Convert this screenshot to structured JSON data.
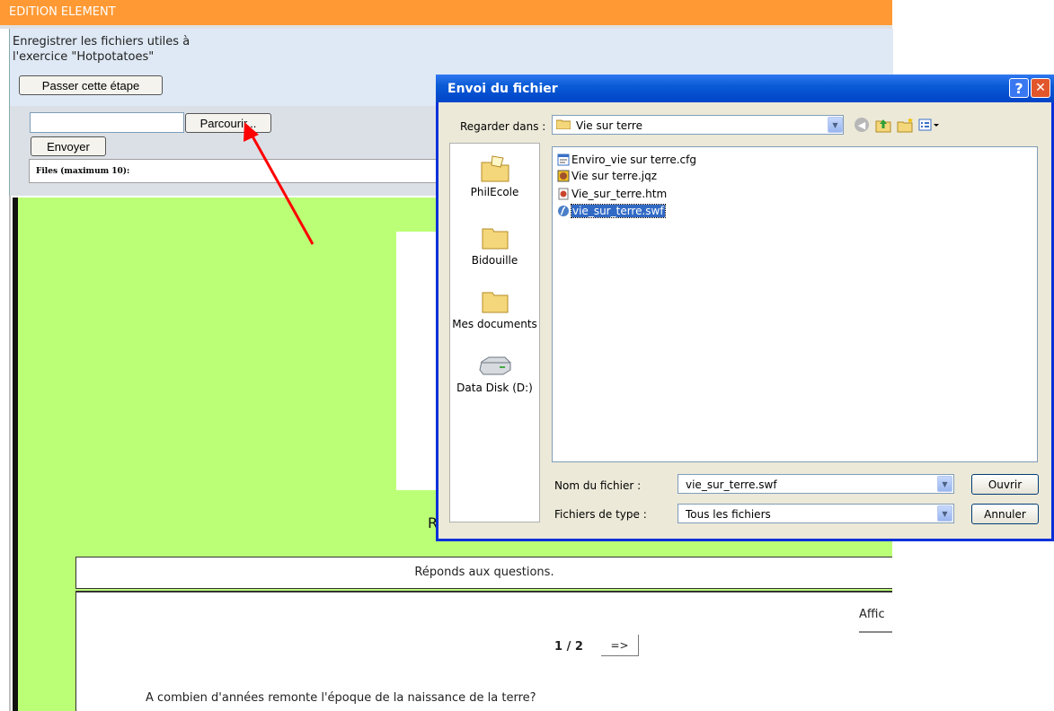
{
  "page": {
    "header_title": "EDITION ELEMENT",
    "instructions": [
      "Enregistrer les fichiers utiles à",
      "l'exercice \"Hotpotatoes\""
    ],
    "skip_button": "Passer cette étape",
    "browse_button": "Parcourir...",
    "send_button": "Envoyer",
    "files_label": "Files (maximum 10):",
    "file_input_value": ""
  },
  "exercise": {
    "partial_heading": "R",
    "instruction_bar": "Réponds aux questions.",
    "show_all_partial": "Affic",
    "page_indicator": "1 / 2",
    "next_button": "=>",
    "question": "A combien d'années remonte l'époque de la naissance de la terre?"
  },
  "dialog": {
    "title": "Envoi du fichier",
    "help_button": "?",
    "close_button": "✕",
    "look_in_label": "Regarder dans :",
    "look_in_value": "Vie sur terre",
    "places": [
      {
        "label": "PhilEcole",
        "icon": "folder-special-icon"
      },
      {
        "label": "Bidouille",
        "icon": "folder-icon"
      },
      {
        "label": "Mes documents",
        "icon": "folder-icon"
      },
      {
        "label": "Data Disk (D:)",
        "icon": "disk-drive-icon"
      }
    ],
    "files": [
      {
        "name": "Enviro_vie sur terre.cfg",
        "icon": "cfg-file-icon",
        "selected": false
      },
      {
        "name": "Vie sur terre.jqz",
        "icon": "hotpotatoes-file-icon",
        "selected": false
      },
      {
        "name": "Vie_sur_terre.htm",
        "icon": "html-file-icon",
        "selected": false
      },
      {
        "name": "vie_sur_terre.swf",
        "icon": "flash-file-icon",
        "selected": true
      }
    ],
    "filename_label": "Nom du fichier :",
    "filename_value": "vie_sur_terre.swf",
    "filetype_label": "Fichiers de type :",
    "filetype_value": "Tous les fichiers",
    "open_button": "Ouvrir",
    "cancel_button": "Annuler"
  },
  "colors": {
    "header": "#ff9933",
    "exercise_background": "#bbff77",
    "dialog_titlebar": "#0a5bd6",
    "annotation_arrow": "#ff0000",
    "selection": "#316ac5"
  }
}
